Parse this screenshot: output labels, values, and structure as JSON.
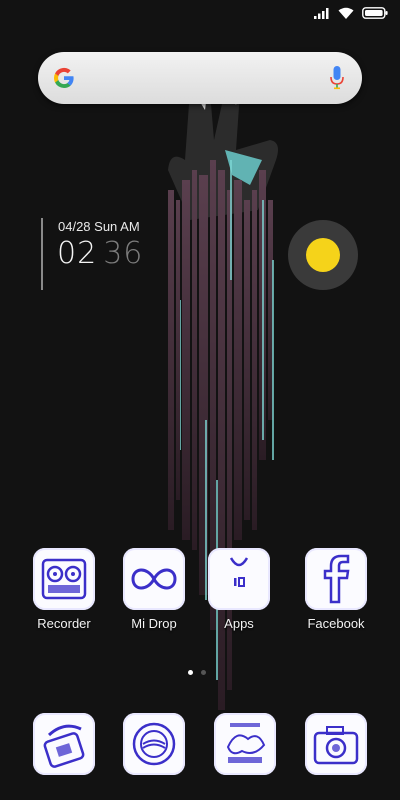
{
  "status_bar": {
    "icons": [
      "signal-icon",
      "wifi-icon",
      "battery-icon"
    ]
  },
  "search": {
    "logo": "google-logo",
    "voice_icon": "mic-icon"
  },
  "clock_widget": {
    "date": "04/28 Sun AM",
    "hour": "02",
    "minute": "36"
  },
  "assistant": {
    "color": "#f5d31a"
  },
  "home_apps": [
    {
      "label": "Recorder",
      "icon": "recorder-icon"
    },
    {
      "label": "Mi Drop",
      "icon": "mi-drop-icon"
    },
    {
      "label": "Apps",
      "icon": "apps-store-icon"
    },
    {
      "label": "Facebook",
      "icon": "facebook-icon"
    }
  ],
  "page_indicator": {
    "pages": 2,
    "current": 1
  },
  "dock_apps": [
    {
      "icon": "phone-icon"
    },
    {
      "icon": "messaging-icon"
    },
    {
      "icon": "themed-app-icon"
    },
    {
      "icon": "camera-icon"
    }
  ],
  "colors": {
    "background": "#121212",
    "icon_ink": "#3b2fc9",
    "icon_paper": "#fbfbff"
  }
}
